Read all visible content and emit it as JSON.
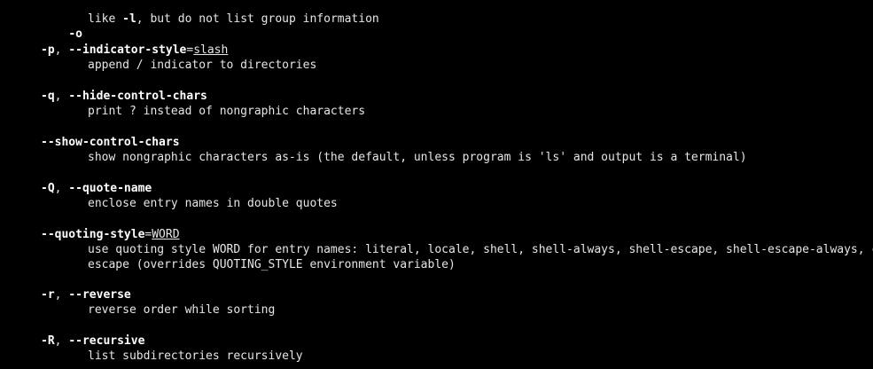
{
  "entries": [
    {
      "opt": {
        "parts": [
          "-o"
        ]
      },
      "inline_desc": {
        "pre": "like ",
        "bold": "-l",
        "post": ", but do not list group information"
      }
    },
    {
      "opt": {
        "short": "-p",
        "sep": ", ",
        "long": "--indicator-style",
        "eq": "=",
        "arg": "slash"
      },
      "desc": [
        "append / indicator to directories"
      ]
    },
    {
      "opt": {
        "short": "-q",
        "sep": ", ",
        "long": "--hide-control-chars"
      },
      "desc": [
        "print ? instead of nongraphic characters"
      ]
    },
    {
      "opt": {
        "long": "--show-control-chars"
      },
      "desc": [
        "show nongraphic characters as-is (the default, unless program is 'ls' and output is a terminal)"
      ]
    },
    {
      "opt": {
        "short": "-Q",
        "sep": ", ",
        "long": "--quote-name"
      },
      "desc": [
        "enclose entry names in double quotes"
      ]
    },
    {
      "opt": {
        "long": "--quoting-style",
        "eq": "=",
        "arg": "WORD"
      },
      "desc": [
        "use quoting style WORD for entry names: literal, locale, shell, shell-always, shell-escape, shell-escape-always, c,",
        "escape (overrides QUOTING_STYLE environment variable)"
      ]
    },
    {
      "opt": {
        "short": "-r",
        "sep": ", ",
        "long": "--reverse"
      },
      "desc": [
        "reverse order while sorting"
      ]
    },
    {
      "opt": {
        "short": "-R",
        "sep": ", ",
        "long": "--recursive"
      },
      "desc": [
        "list subdirectories recursively"
      ]
    }
  ]
}
